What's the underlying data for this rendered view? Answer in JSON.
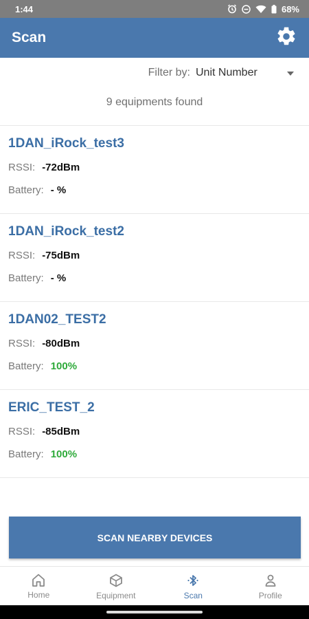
{
  "status_bar": {
    "time": "1:44",
    "battery_percent": "68%",
    "icons": [
      "alarm-icon",
      "do-not-disturb-icon",
      "wifi-icon",
      "battery-icon"
    ]
  },
  "app_bar": {
    "title": "Scan",
    "settings_icon": "gear-icon"
  },
  "filter": {
    "label": "Filter by:",
    "selected": "Unit Number"
  },
  "found_count": "9 equipments found",
  "labels": {
    "rssi": "RSSI:",
    "battery": "Battery:"
  },
  "devices": [
    {
      "name": "1DAN_iRock_test3",
      "rssi": "-72dBm",
      "battery": "- %"
    },
    {
      "name": "1DAN_iRock_test2",
      "rssi": "-75dBm",
      "battery": "- %"
    },
    {
      "name": "1DAN02_TEST2",
      "rssi": "-80dBm",
      "battery": "100%"
    },
    {
      "name": "ERIC_TEST_2",
      "rssi": "-85dBm",
      "battery": "100%"
    }
  ],
  "scan_button": "SCAN NEARBY DEVICES",
  "bottom_nav": {
    "items": [
      {
        "label": "Home",
        "icon": "home-icon"
      },
      {
        "label": "Equipment",
        "icon": "box-icon"
      },
      {
        "label": "Scan",
        "icon": "bluetooth-icon"
      },
      {
        "label": "Profile",
        "icon": "person-icon"
      }
    ],
    "active": "Scan"
  },
  "colors": {
    "primary": "#4a78ad",
    "device_name": "#3b6ea5",
    "battery_good": "#2eaa3a",
    "status_bar": "#7e7e7e"
  }
}
